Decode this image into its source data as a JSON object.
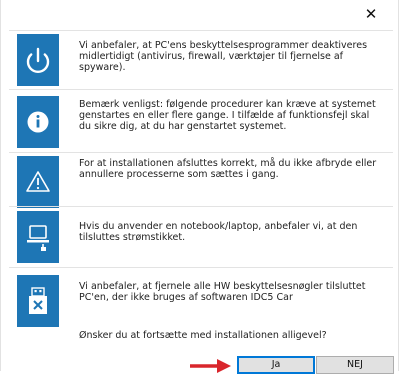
{
  "window": {
    "close_glyph": "✕"
  },
  "items": [
    {
      "icon": "power-icon",
      "text": "Vi anbefaler, at PC'ens beskyttelsesprogrammer deaktiveres midlertidigt (antivirus, firewall, værktøjer til fjernelse af spyware)."
    },
    {
      "icon": "info-icon",
      "text": "Bemærk venligst: følgende procedurer kan kræve at systemet genstartes en eller flere gange. I tilfælde af funktionsfejl skal du sikre dig, at du har genstartet systemet."
    },
    {
      "icon": "warning-icon",
      "text": "For at installationen afsluttes korrekt, må du ikke afbryde eller annullere processerne som sættes i gang."
    },
    {
      "icon": "laptop-plug-icon",
      "text": "Hvis du anvender en notebook/laptop, anbefaler vi, at den tilsluttes strømstikket."
    },
    {
      "icon": "usb-key-remove-icon",
      "text": "Vi anbefaler, at fjernele alle HW beskyttelsesnøgler tilsluttet PC'en, der ikke bruges af softwaren IDC5 Car"
    }
  ],
  "question": "Ønsker du at fortsætte med installationen alligevel?",
  "buttons": {
    "yes": "Ja",
    "no": "NEJ"
  },
  "colors": {
    "tile": "#1e76b5",
    "arrow": "#d9262c",
    "focus": "#0078d7"
  }
}
